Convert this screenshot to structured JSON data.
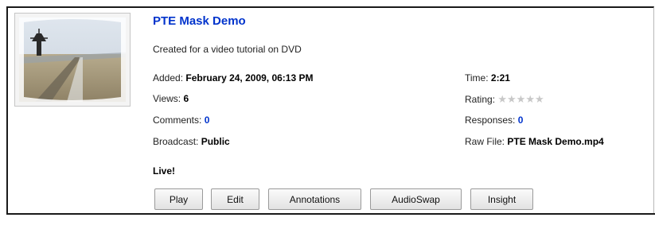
{
  "video": {
    "title": "PTE Mask Demo",
    "description": "Created for a video tutorial on DVD",
    "thumbnail_icon": "video-thumbnail-winter-landscape"
  },
  "details": {
    "added_label": "Added:",
    "added_value": "February 24, 2009, 06:13 PM",
    "views_label": "Views:",
    "views_value": "6",
    "comments_label": "Comments:",
    "comments_value": "0",
    "broadcast_label": "Broadcast:",
    "broadcast_value": "Public",
    "time_label": "Time:",
    "time_value": "2:21",
    "rating_label": "Rating:",
    "rating_stars": "★★★★★",
    "rating_value": 0,
    "responses_label": "Responses:",
    "responses_value": "0",
    "raw_file_label": "Raw File:",
    "raw_file_value": "PTE Mask Demo.mp4"
  },
  "status": "Live!",
  "buttons": {
    "play": "Play",
    "edit": "Edit",
    "annotations": "Annotations",
    "audioswap": "AudioSwap",
    "insight": "Insight"
  },
  "colors": {
    "link": "#0033cc",
    "star_empty": "#c8c8c8"
  }
}
